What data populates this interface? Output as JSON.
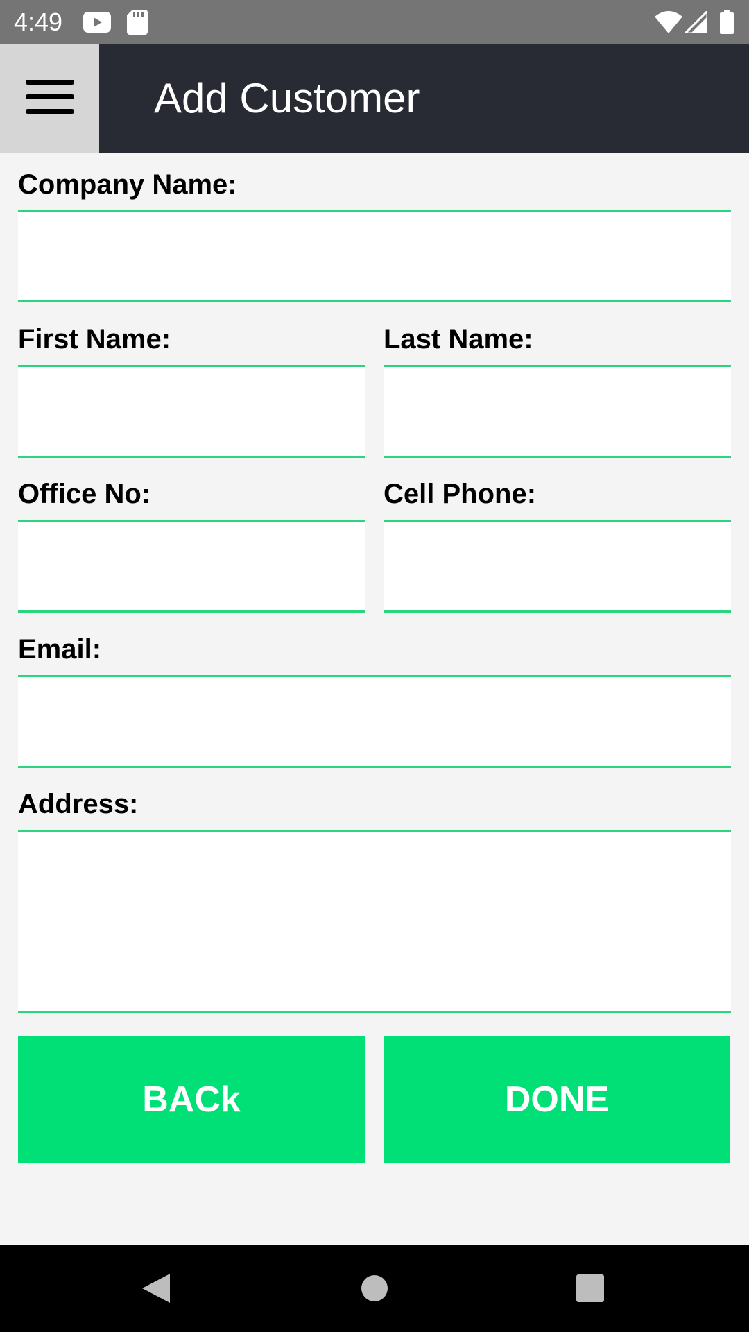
{
  "status_bar": {
    "time": "4:49",
    "icons": [
      "youtube-icon",
      "sd-card-icon",
      "wifi-icon",
      "signal-icon",
      "battery-icon"
    ]
  },
  "app_bar": {
    "title": "Add Customer",
    "menu_icon": "hamburger-menu-icon",
    "background": "#282b33"
  },
  "form": {
    "company_name": {
      "label": "Company Name:",
      "value": ""
    },
    "first_name": {
      "label": "First Name:",
      "value": ""
    },
    "last_name": {
      "label": "Last Name:",
      "value": ""
    },
    "office_no": {
      "label": "Office No:",
      "value": ""
    },
    "cell_phone": {
      "label": "Cell Phone:",
      "value": ""
    },
    "email": {
      "label": "Email:",
      "value": ""
    },
    "address": {
      "label": "Address:",
      "value": ""
    }
  },
  "buttons": {
    "back_label": "BACk",
    "done_label": "DONE"
  },
  "colors": {
    "accent": "#00e077",
    "field_border": "#2bd57d",
    "background": "#f4f4f4"
  },
  "nav_bar": {
    "icons": [
      "back-triangle-icon",
      "home-circle-icon",
      "recents-square-icon"
    ]
  }
}
